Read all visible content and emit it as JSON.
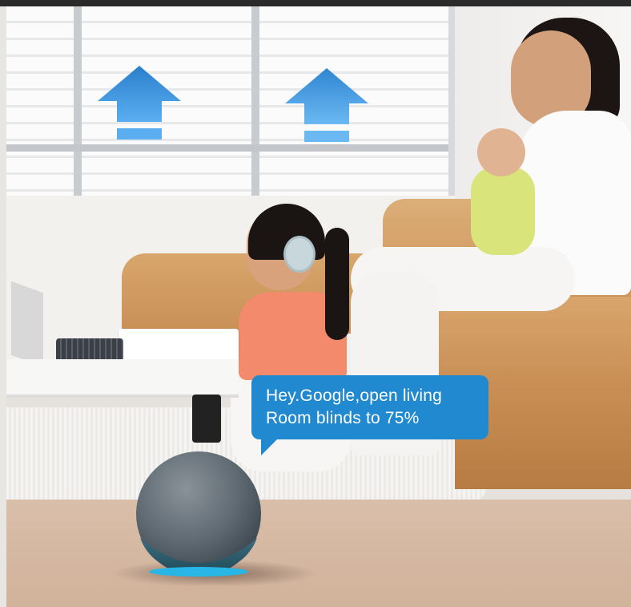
{
  "scene": {
    "bubble": {
      "line1": "Hey.Google,open living",
      "line2": "Room blinds to 75%"
    },
    "icons": [
      "up-arrow-icon",
      "up-arrow-icon",
      "speaker-ring-icon"
    ],
    "colors": {
      "bubble": "#2189cf",
      "arrow": "#2f8fd8",
      "sofa": "#d09a5f",
      "counter": "#d6b9a3",
      "speaker_ring": "#28b6e6"
    }
  }
}
